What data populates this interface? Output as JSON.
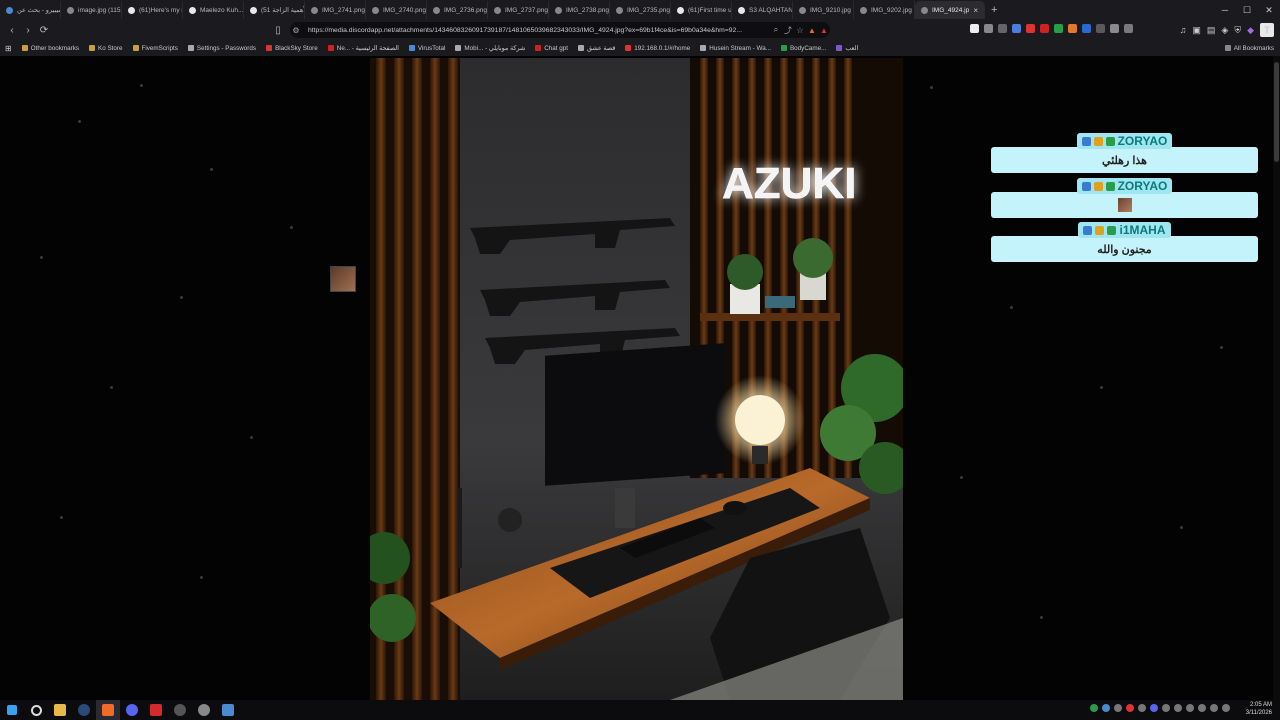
{
  "tabs": [
    {
      "label": "شيبيرو - بحث عن gle"
    },
    {
      "label": "image.jpg (1152×"
    },
    {
      "label": "(61)Here's my ne"
    },
    {
      "label": "Maelezo Kuh..."
    },
    {
      "label": "(الأهمية الزاجة 51)"
    },
    {
      "label": "IMG_2741.png (2"
    },
    {
      "label": "IMG_2740.png (2"
    },
    {
      "label": "IMG_2736.png (2"
    },
    {
      "label": "IMG_2737.png (2"
    },
    {
      "label": "IMG_2738.png (2"
    },
    {
      "label": "IMG_2735.png (2"
    },
    {
      "label": "(61)First time usi"
    },
    {
      "label": "S3 ALQAHTANI J"
    },
    {
      "label": "IMG_9210.jpg (2"
    },
    {
      "label": "IMG_9202.jpg (3"
    },
    {
      "label": "IMG_4924.jp",
      "active": true
    }
  ],
  "url": "https://media.discordapp.net/attachments/1434608326091739187/1481065039682343033/IMG_4924.jpg?ex=69b1f4ce&is=69b0a34e&hm=92...",
  "bookmarks": [
    "Other bookmarks",
    "Ko Store",
    "FivemScripts",
    "Settings - Passwords",
    "BlackSky Store",
    "Ne... - الصفحة الرئيسية",
    "VirusTotal",
    "Mobi... - شركة موبايلي",
    "Chat gpt",
    "قصة عشق",
    "192.168.0.1/#/home",
    "Husein Stream - Wa...",
    "BodyCame...",
    "العب"
  ],
  "all_bookmarks": "All Bookmarks",
  "neon_sign": "AZUKI",
  "chat_messages": [
    {
      "user": "ZORYAO",
      "text": "هذا رهلئي"
    },
    {
      "user": "ZORYAO",
      "text": ""
    },
    {
      "user": "i1MAHA",
      "text": "مجنون والله"
    }
  ],
  "clock": {
    "time": "2:05 AM",
    "date": "3/11/2026"
  },
  "colors": {
    "chat_bubble": "#c5f3fb",
    "chat_name": "#0a7a7a",
    "name_badge": "#9fe6f0"
  }
}
